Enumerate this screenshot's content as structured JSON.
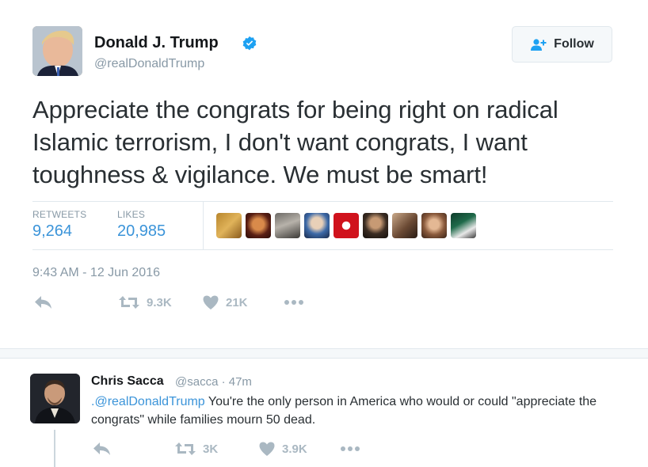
{
  "tweet": {
    "author": {
      "display_name": "Donald J. Trump",
      "handle": "@realDonaldTrump",
      "verified": true
    },
    "follow_button_label": "Follow",
    "text": "Appreciate the congrats for being right on radical Islamic terrorism, I don't want congrats, I want toughness & vigilance. We must be smart!",
    "stats": {
      "retweets_label": "RETWEETS",
      "retweets_value": "9,264",
      "likes_label": "LIKES",
      "likes_value": "20,985"
    },
    "timestamp": "9:43 AM - 12 Jun 2016",
    "actions": {
      "retweet_count": "9.3K",
      "like_count": "21K"
    }
  },
  "reply": {
    "author": {
      "display_name": "Chris Sacca",
      "handle": "@sacca · 47m"
    },
    "mention": ".@realDonaldTrump",
    "text": " You're the only person in America who would or could \"appreciate the congrats\" while families mourn 50 dead.",
    "actions": {
      "retweet_count": "3K",
      "like_count": "3.9K"
    }
  },
  "colors": {
    "link_blue": "#3b94d9",
    "verified_blue": "#1da1f2",
    "muted_gray": "#8899a6",
    "icon_gray": "#aab8c2",
    "border_gray": "#e1e8ed"
  },
  "icons": [
    "verified-badge-icon",
    "follow-user-plus-icon",
    "reply-arrow-icon",
    "retweet-icon",
    "heart-icon",
    "more-dots-icon"
  ]
}
